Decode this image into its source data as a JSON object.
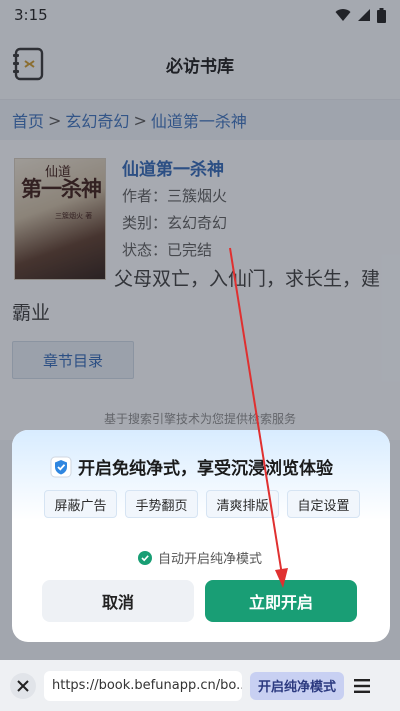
{
  "status": {
    "time": "3:15"
  },
  "app": {
    "title": "必访书库"
  },
  "breadcrumb": [
    "首页",
    "玄幻奇幻",
    "仙道第一杀神"
  ],
  "book": {
    "title": "仙道第一杀神",
    "author": "作者：三簇烟火",
    "category": "类别：玄幻奇幻",
    "status": "状态：已完结",
    "description": "父母双亡，入仙门，求长生，建霸业",
    "cover_title_top": "仙道",
    "cover_title": "第一杀神",
    "cover_author": "三簇烟火 著"
  },
  "chapter_button": "章节目录",
  "disclaimer": "基于搜索引擎技术为您提供检索服务",
  "dialog": {
    "title": "开启免纯净式，享受沉浸浏览体验",
    "features": [
      "屏蔽广告",
      "手势翻页",
      "清爽排版",
      "自定设置"
    ],
    "auto_label": "自动开启纯净模式",
    "cancel": "取消",
    "confirm": "立即开启"
  },
  "bottombar": {
    "url": "https://book.befunapp.cn/bo...",
    "pure_mode": "开启纯净模式"
  },
  "colors": {
    "accent": "#199e75",
    "link": "#2f65b2",
    "annotation": "#e03030"
  }
}
